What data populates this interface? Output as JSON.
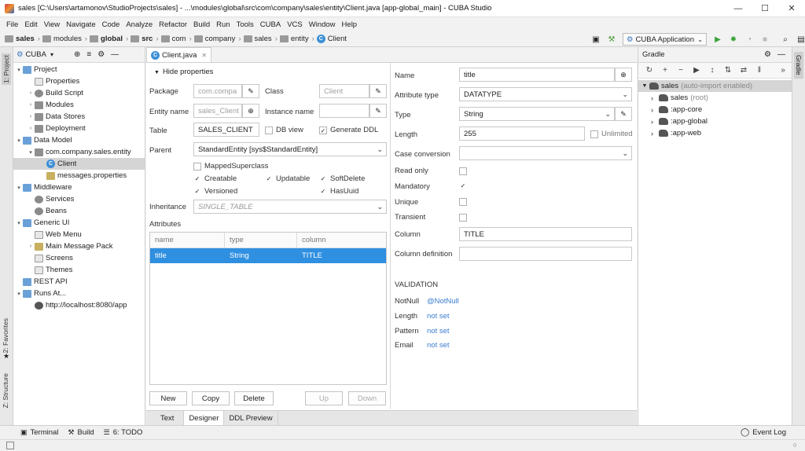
{
  "window": {
    "title": "sales [C:\\Users\\artamonov\\StudioProjects\\sales] - ...\\modules\\global\\src\\com\\company\\sales\\entity\\Client.java [app-global_main] - CUBA Studio"
  },
  "menu": [
    "File",
    "Edit",
    "View",
    "Navigate",
    "Code",
    "Analyze",
    "Refactor",
    "Build",
    "Run",
    "Tools",
    "CUBA",
    "VCS",
    "Window",
    "Help"
  ],
  "breadcrumbs": [
    {
      "label": "sales",
      "bold": true
    },
    {
      "label": "modules",
      "bold": false
    },
    {
      "label": "global",
      "bold": true
    },
    {
      "label": "src",
      "bold": true
    },
    {
      "label": "com",
      "bold": false
    },
    {
      "label": "company",
      "bold": false
    },
    {
      "label": "sales",
      "bold": false
    },
    {
      "label": "entity",
      "bold": false
    }
  ],
  "breadcrumb_class": "Client",
  "run_config": "CUBA Application",
  "side_tabs": {
    "project": "1: Project",
    "favorites": "2: Favorites",
    "structure": "Z: Structure",
    "gradle": "Gradle"
  },
  "project_panel": {
    "selector": "CUBA",
    "tree": [
      {
        "label": "Project",
        "level": 0,
        "arrow": "▾",
        "icon": "pfolder"
      },
      {
        "label": "Properties",
        "level": 1,
        "arrow": "",
        "icon": "file"
      },
      {
        "label": "Build Script",
        "level": 1,
        "arrow": "›",
        "icon": "gear"
      },
      {
        "label": "Modules",
        "level": 1,
        "arrow": "›",
        "icon": "folder"
      },
      {
        "label": "Data Stores",
        "level": 1,
        "arrow": "›",
        "icon": "folder"
      },
      {
        "label": "Deployment",
        "level": 1,
        "arrow": "›",
        "icon": "folder"
      },
      {
        "label": "Data Model",
        "level": 0,
        "arrow": "▾",
        "icon": "pfolder"
      },
      {
        "label": "com.company.sales.entity",
        "level": 1,
        "arrow": "▾",
        "icon": "folder"
      },
      {
        "label": "Client",
        "level": 2,
        "arrow": "",
        "icon": "class",
        "selected": true
      },
      {
        "label": "messages.properties",
        "level": 2,
        "arrow": "",
        "icon": "prop"
      },
      {
        "label": "Middleware",
        "level": 0,
        "arrow": "▾",
        "icon": "pfolder"
      },
      {
        "label": "Services",
        "level": 1,
        "arrow": "",
        "icon": "gear"
      },
      {
        "label": "Beans",
        "level": 1,
        "arrow": "",
        "icon": "gear"
      },
      {
        "label": "Generic UI",
        "level": 0,
        "arrow": "▾",
        "icon": "pfolder"
      },
      {
        "label": "Web Menu",
        "level": 1,
        "arrow": "",
        "icon": "file"
      },
      {
        "label": "Main Message Pack",
        "level": 1,
        "arrow": "›",
        "icon": "prop"
      },
      {
        "label": "Screens",
        "level": 1,
        "arrow": "",
        "icon": "file"
      },
      {
        "label": "Themes",
        "level": 1,
        "arrow": "",
        "icon": "file"
      },
      {
        "label": "REST API",
        "level": 0,
        "arrow": "",
        "icon": "pfolder"
      },
      {
        "label": "Runs At...",
        "level": 0,
        "arrow": "▾",
        "icon": "pfolder"
      },
      {
        "label": "http://localhost:8080/app",
        "level": 1,
        "arrow": "",
        "icon": "globe"
      }
    ]
  },
  "editor": {
    "tab": "Client.java",
    "hide_properties": "Hide properties",
    "labels": {
      "package": "Package",
      "class": "Class",
      "entity_name": "Entity name",
      "instance_name": "Instance name",
      "table": "Table",
      "parent": "Parent",
      "inheritance": "Inheritance",
      "attributes": "Attributes"
    },
    "values": {
      "package": "com.compa",
      "class": "Client",
      "entity_name": "sales_Client",
      "instance_name": "",
      "table": "SALES_CLIENT",
      "parent": "StandardEntity [sys$StandardEntity]",
      "inheritance": "SINGLE_TABLE"
    },
    "checks": {
      "db_view": "DB view",
      "generate_ddl": "Generate DDL",
      "mapped_superclass": "MappedSuperclass",
      "creatable": "Creatable",
      "updatable": "Updatable",
      "soft_delete": "SoftDelete",
      "versioned": "Versioned",
      "has_uuid": "HasUuid"
    },
    "table": {
      "headers": [
        "name",
        "type",
        "column"
      ],
      "rows": [
        [
          "title",
          "String",
          "TITLE"
        ]
      ]
    },
    "buttons": {
      "new": "New",
      "copy": "Copy",
      "delete": "Delete",
      "up": "Up",
      "down": "Down"
    },
    "bottom_tabs": [
      "Text",
      "Designer",
      "DDL Preview"
    ]
  },
  "attribute": {
    "labels": {
      "name": "Name",
      "attribute_type": "Attribute type",
      "type": "Type",
      "length": "Length",
      "case_conversion": "Case conversion",
      "read_only": "Read only",
      "mandatory": "Mandatory",
      "unique": "Unique",
      "transient": "Transient",
      "column": "Column",
      "column_definition": "Column definition"
    },
    "values": {
      "name": "title",
      "attribute_type": "DATATYPE",
      "type": "String",
      "length": "255",
      "case_conversion": "",
      "column": "TITLE",
      "column_definition": ""
    },
    "unlimited": "Unlimited",
    "validation": {
      "heading": "VALIDATION",
      "items": [
        {
          "label": "NotNull",
          "value": "@NotNull"
        },
        {
          "label": "Length",
          "value": "not set"
        },
        {
          "label": "Pattern",
          "value": "not set"
        },
        {
          "label": "Email",
          "value": "not set"
        }
      ]
    }
  },
  "gradle": {
    "title": "Gradle",
    "root": "sales",
    "root_note": "(auto-import enabled)",
    "children": [
      {
        "label": "sales",
        "note": "(root)"
      },
      {
        "label": ":app-core",
        "note": ""
      },
      {
        "label": ":app-global",
        "note": ""
      },
      {
        "label": ":app-web",
        "note": ""
      }
    ]
  },
  "bottom_tools": {
    "terminal": "Terminal",
    "build": "Build",
    "todo": "6: TODO",
    "event_log": "Event Log"
  }
}
